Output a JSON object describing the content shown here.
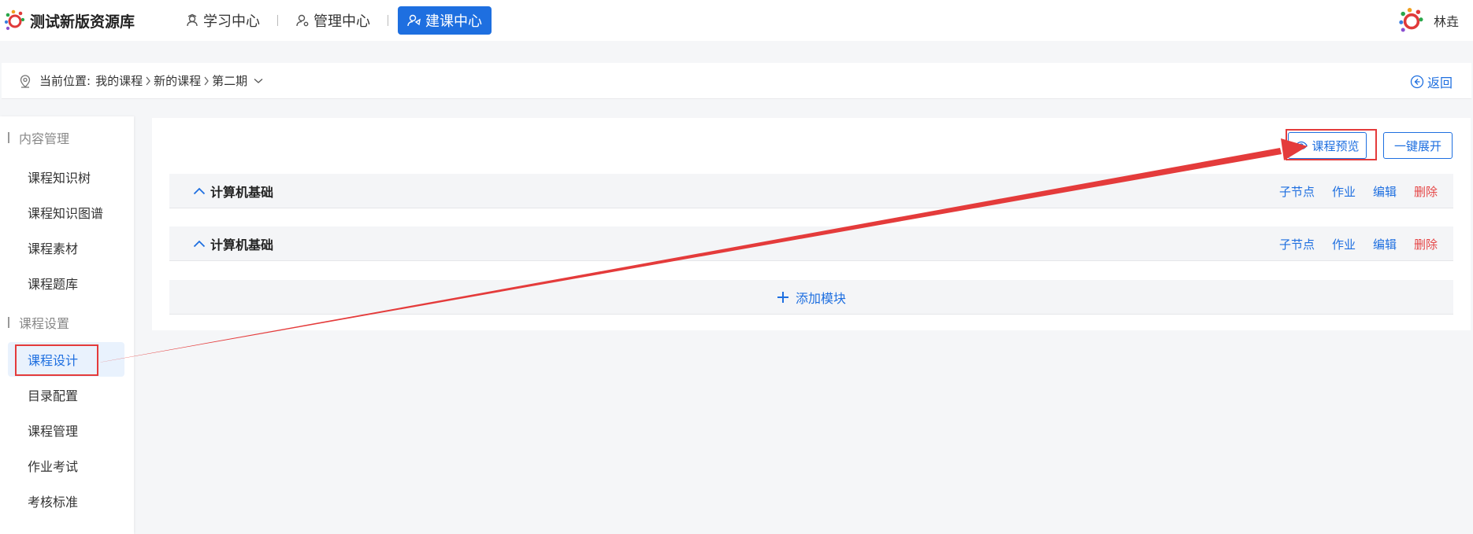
{
  "header": {
    "app_title": "测试新版资源库",
    "nav": [
      {
        "label": "学习中心",
        "icon": "user-cap-icon"
      },
      {
        "label": "管理中心",
        "icon": "user-gear-icon"
      },
      {
        "label": "建课中心",
        "icon": "user-share-icon",
        "active": true
      }
    ],
    "user_name": "林垚"
  },
  "breadcrumb": {
    "prefix": "当前位置:",
    "items": [
      "我的课程",
      "新的课程",
      "第二期"
    ],
    "back_label": "返回"
  },
  "sidebar": {
    "section1": "内容管理",
    "section1_items": [
      "课程知识树",
      "课程知识图谱",
      "课程素材",
      "课程题库"
    ],
    "section2": "课程设置",
    "section2_items": [
      "课程设计",
      "目录配置",
      "课程管理",
      "作业考试",
      "考核标准"
    ],
    "active_item": "课程设计"
  },
  "main": {
    "preview_label": "课程预览",
    "expand_label": "一键展开",
    "modules": [
      {
        "name": "计算机基础"
      },
      {
        "name": "计算机基础"
      }
    ],
    "ops": {
      "child": "子节点",
      "homework": "作业",
      "edit": "编辑",
      "delete": "删除"
    },
    "add_label": "添加模块"
  },
  "colors": {
    "accent": "#1e6fe0",
    "danger": "#e54545",
    "annotation": "#e43b3b"
  }
}
